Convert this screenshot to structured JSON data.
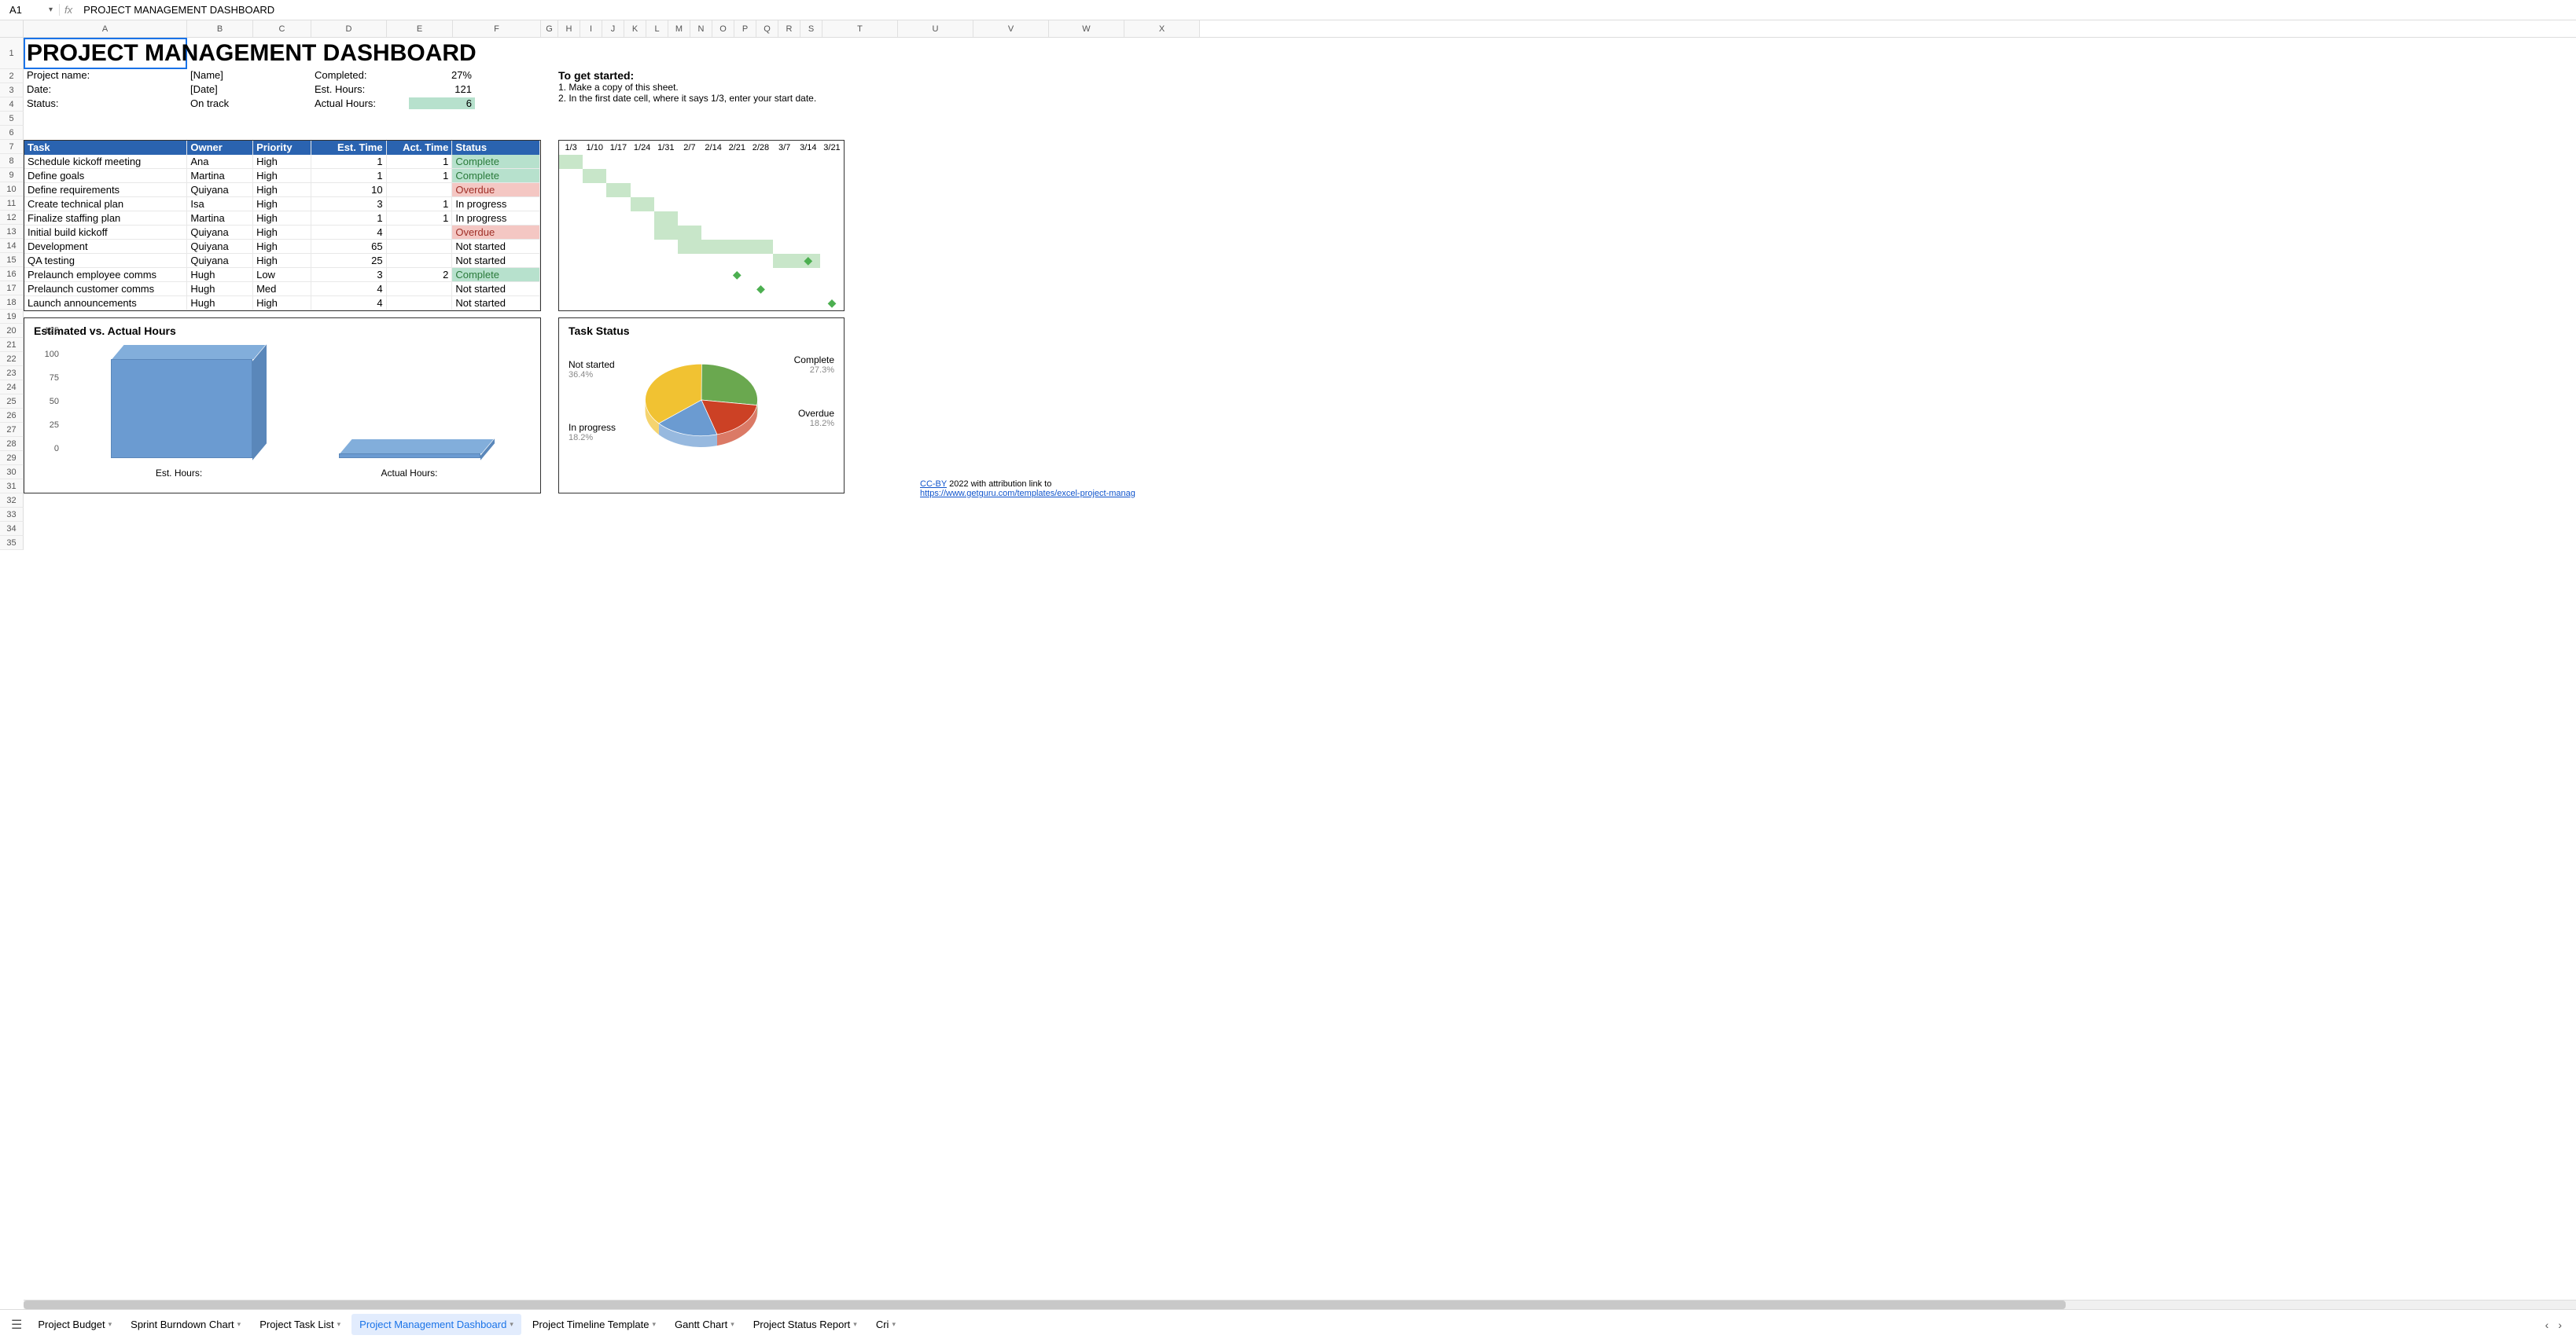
{
  "namebox": "A1",
  "formula": "PROJECT MANAGEMENT DASHBOARD",
  "columns": {
    "labels": [
      "A",
      "B",
      "C",
      "D",
      "E",
      "F",
      "G",
      "H",
      "I",
      "J",
      "K",
      "L",
      "M",
      "N",
      "O",
      "P",
      "Q",
      "R",
      "S",
      "T",
      "U",
      "V",
      "W",
      "X"
    ],
    "widths": [
      208,
      84,
      74,
      96,
      84,
      112,
      22,
      28,
      28,
      28,
      28,
      28,
      28,
      28,
      28,
      28,
      28,
      28,
      28,
      96,
      96,
      96,
      96,
      96
    ]
  },
  "rows": [
    "1",
    "2",
    "3",
    "4",
    "5",
    "6",
    "7",
    "8",
    "9",
    "10",
    "11",
    "12",
    "13",
    "14",
    "15",
    "16",
    "17",
    "18",
    "19",
    "20",
    "21",
    "22",
    "23",
    "24",
    "25",
    "26",
    "27",
    "28",
    "29",
    "30",
    "31",
    "32",
    "33",
    "34",
    "35"
  ],
  "title": "PROJECT MANAGEMENT DASHBOARD",
  "meta": {
    "left_labels": [
      "Project name:",
      "Date:",
      "Status:"
    ],
    "left_values": [
      "[Name]",
      "[Date]",
      "On track"
    ],
    "right_labels": [
      "Completed:",
      "Est. Hours:",
      "Actual Hours:"
    ],
    "right_values": [
      "27%",
      "121",
      "6"
    ]
  },
  "instructions": {
    "heading": "To get started:",
    "lines": [
      "1. Make a copy of this sheet.",
      "2. In the first date cell, where it says 1/3, enter your start date."
    ]
  },
  "task_headers": [
    "Task",
    "Owner",
    "Priority",
    "Est. Time",
    "Act. Time",
    "Status"
  ],
  "tasks": [
    {
      "task": "Schedule kickoff meeting",
      "owner": "Ana",
      "priority": "High",
      "est": "1",
      "act": "1",
      "status": "Complete",
      "statusClass": "status-complete"
    },
    {
      "task": "Define goals",
      "owner": "Martina",
      "priority": "High",
      "est": "1",
      "act": "1",
      "status": "Complete",
      "statusClass": "status-complete"
    },
    {
      "task": "Define requirements",
      "owner": "Quiyana",
      "priority": "High",
      "est": "10",
      "act": "",
      "status": "Overdue",
      "statusClass": "status-overdue"
    },
    {
      "task": "Create technical plan",
      "owner": "Isa",
      "priority": "High",
      "est": "3",
      "act": "1",
      "status": "In progress",
      "statusClass": ""
    },
    {
      "task": "Finalize staffing plan",
      "owner": "Martina",
      "priority": "High",
      "est": "1",
      "act": "1",
      "status": "In progress",
      "statusClass": ""
    },
    {
      "task": "Initial build kickoff",
      "owner": "Quiyana",
      "priority": "High",
      "est": "4",
      "act": "",
      "status": "Overdue",
      "statusClass": "status-overdue"
    },
    {
      "task": "Development",
      "owner": "Quiyana",
      "priority": "High",
      "est": "65",
      "act": "",
      "status": "Not started",
      "statusClass": ""
    },
    {
      "task": "QA testing",
      "owner": "Quiyana",
      "priority": "High",
      "est": "25",
      "act": "",
      "status": "Not started",
      "statusClass": ""
    },
    {
      "task": "Prelaunch employee comms",
      "owner": "Hugh",
      "priority": "Low",
      "est": "3",
      "act": "2",
      "status": "Complete",
      "statusClass": "status-complete"
    },
    {
      "task": "Prelaunch customer comms",
      "owner": "Hugh",
      "priority": "Med",
      "est": "4",
      "act": "",
      "status": "Not started",
      "statusClass": ""
    },
    {
      "task": "Launch announcements",
      "owner": "Hugh",
      "priority": "High",
      "est": "4",
      "act": "",
      "status": "Not started",
      "statusClass": ""
    }
  ],
  "gantt": {
    "dates": [
      "1/3",
      "1/10",
      "1/17",
      "1/24",
      "1/31",
      "2/7",
      "2/14",
      "2/21",
      "2/28",
      "3/7",
      "3/14",
      "3/21"
    ],
    "rows": [
      [
        0
      ],
      [
        1
      ],
      [
        2
      ],
      [
        3
      ],
      [
        4
      ],
      [
        4,
        5
      ],
      [
        5,
        6,
        7,
        8
      ],
      [
        9,
        10
      ],
      [],
      [],
      []
    ],
    "diamonds": {
      "7": 10,
      "8": 7,
      "9": 8,
      "10": 11
    }
  },
  "chart_data": [
    {
      "type": "bar",
      "title": "Estimated vs. Actual Hours",
      "categories": [
        "Est. Hours:",
        "Actual Hours:"
      ],
      "values": [
        121,
        6
      ],
      "ylim": [
        0,
        125
      ],
      "yticks": [
        0,
        25,
        50,
        75,
        100,
        125
      ]
    },
    {
      "type": "pie",
      "title": "Task Status",
      "series": [
        {
          "name": "Complete",
          "value": 27.3,
          "label": "27.3%",
          "color": "#6aa84f"
        },
        {
          "name": "Overdue",
          "value": 18.2,
          "label": "18.2%",
          "color": "#cc4125"
        },
        {
          "name": "In progress",
          "value": 18.2,
          "label": "18.2%",
          "color": "#6b9bd1"
        },
        {
          "name": "Not started",
          "value": 36.4,
          "label": "36.4%",
          "color": "#f1c232"
        }
      ]
    }
  ],
  "attribution": {
    "text1": "CC-BY",
    "text2": " 2022 with attribution link to",
    "link": "https://www.getguru.com/templates/excel-project-manag"
  },
  "sheets": [
    "Project Budget",
    "Sprint Burndown Chart",
    "Project Task List",
    "Project Management Dashboard",
    "Project Timeline Template",
    "Gantt Chart",
    "Project Status Report",
    "Cri"
  ],
  "active_sheet": 3
}
